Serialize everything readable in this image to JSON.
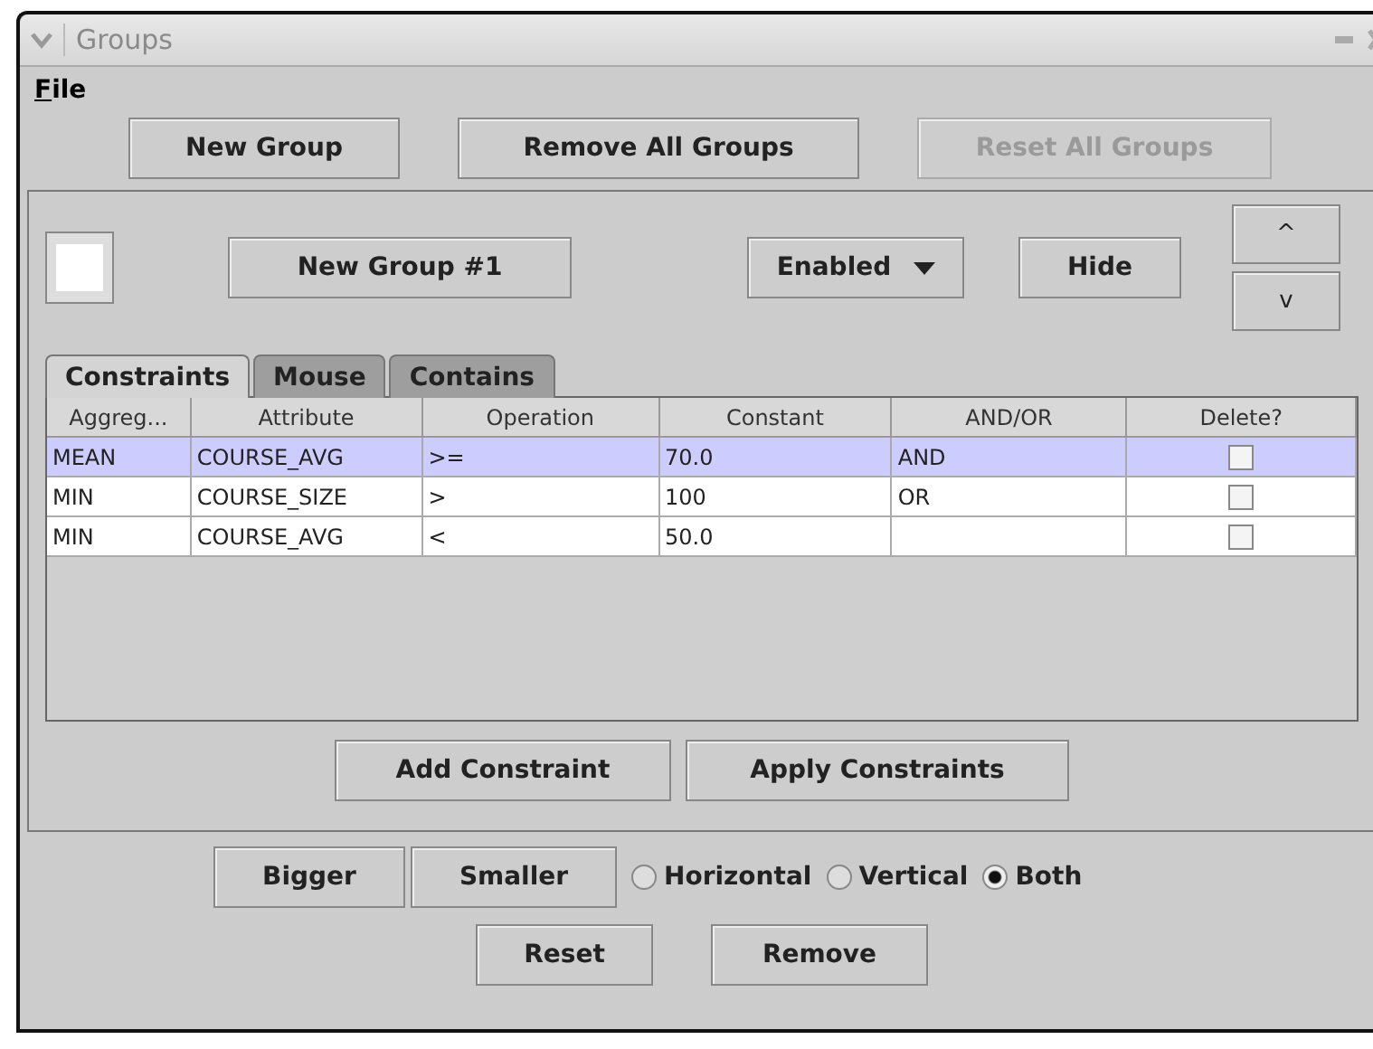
{
  "window": {
    "title": "Groups"
  },
  "menu": [
    {
      "label": "File"
    }
  ],
  "toolbar": [
    {
      "label": "New Group",
      "disabled": false
    },
    {
      "label": "Remove All Groups",
      "disabled": false
    },
    {
      "label": "Reset All Groups",
      "disabled": true
    }
  ],
  "group": {
    "name": "New Group #1",
    "status": "Enabled",
    "hide": "Hide",
    "up": "^",
    "down": "v"
  },
  "tabs": [
    {
      "label": "Constraints",
      "selected": true
    },
    {
      "label": "Mouse",
      "selected": false
    },
    {
      "label": "Contains",
      "selected": false
    }
  ],
  "table": {
    "columns": [
      "Aggreg...",
      "Attribute",
      "Operation",
      "Constant",
      "AND/OR",
      "Delete?"
    ],
    "rows": [
      {
        "cells": [
          "MEAN",
          "COURSE_AVG",
          ">=",
          "70.0",
          "AND"
        ],
        "delete": false,
        "selected": true
      },
      {
        "cells": [
          "MIN",
          "COURSE_SIZE",
          ">",
          "100",
          "OR"
        ],
        "delete": false,
        "selected": false
      },
      {
        "cells": [
          "MIN",
          "COURSE_AVG",
          "<",
          "50.0",
          ""
        ],
        "delete": false,
        "selected": false
      }
    ]
  },
  "constraint_buttons": [
    "Add Constraint",
    "Apply Constraints"
  ],
  "size_buttons": [
    "Bigger",
    "Smaller"
  ],
  "radios": [
    {
      "label": "Horizontal",
      "selected": false
    },
    {
      "label": "Vertical",
      "selected": false
    },
    {
      "label": "Both",
      "selected": true
    }
  ],
  "bottom_buttons": [
    "Reset",
    "Remove"
  ]
}
